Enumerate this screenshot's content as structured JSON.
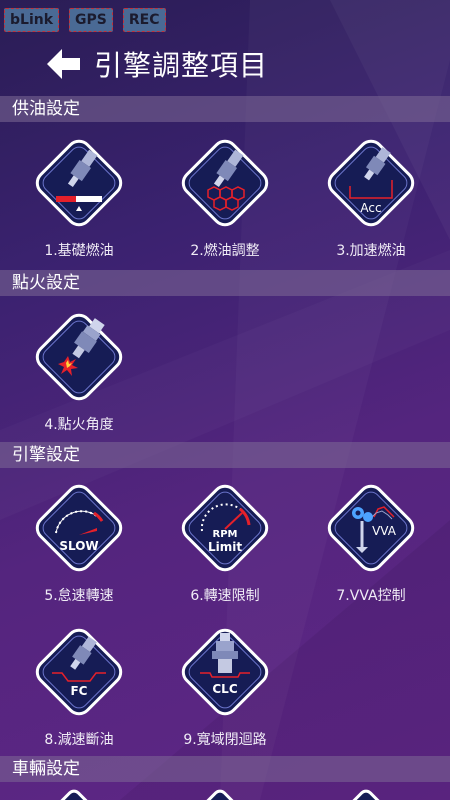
{
  "status": {
    "blink": "bLink",
    "gps": "GPS",
    "rec": "REC"
  },
  "header": {
    "title": "引擎調整項目"
  },
  "sections": {
    "fuel": "供油設定",
    "ignition": "點火設定",
    "engine": "引擎設定",
    "vehicle": "車輛設定"
  },
  "tiles": {
    "base_fuel": {
      "label": "1.基礎燃油",
      "icon": "injector-gauge-icon"
    },
    "fuel_adjust": {
      "label": "2.燃油調整",
      "icon": "injector-hex-icon"
    },
    "accel_fuel": {
      "label": "3.加速燃油",
      "icon": "injector-acc-icon",
      "icon_text": "Acc"
    },
    "ign_angle": {
      "label": "4.點火角度",
      "icon": "spark-plug-icon"
    },
    "idle_speed": {
      "label": "5.怠速轉速",
      "icon": "gauge-slow-icon",
      "icon_text": "SLOW"
    },
    "rpm_limit": {
      "label": "6.轉速限制",
      "icon": "gauge-rpm-limit-icon",
      "icon_text_1": "RPM",
      "icon_text_2": "Limit"
    },
    "vva": {
      "label": "7.VVA控制",
      "icon": "valve-vva-icon",
      "icon_text": "VVA"
    },
    "fuel_cut": {
      "label": "8.減速斷油",
      "icon": "injector-fc-icon",
      "icon_text": "FC"
    },
    "closed_loop": {
      "label": "9.寬域閉迴路",
      "icon": "sensor-clc-icon",
      "icon_text": "CLC"
    }
  },
  "colors": {
    "accent_red": "#e5202a",
    "tile_dark": "#161c55",
    "tile_border": "#ffffff"
  }
}
